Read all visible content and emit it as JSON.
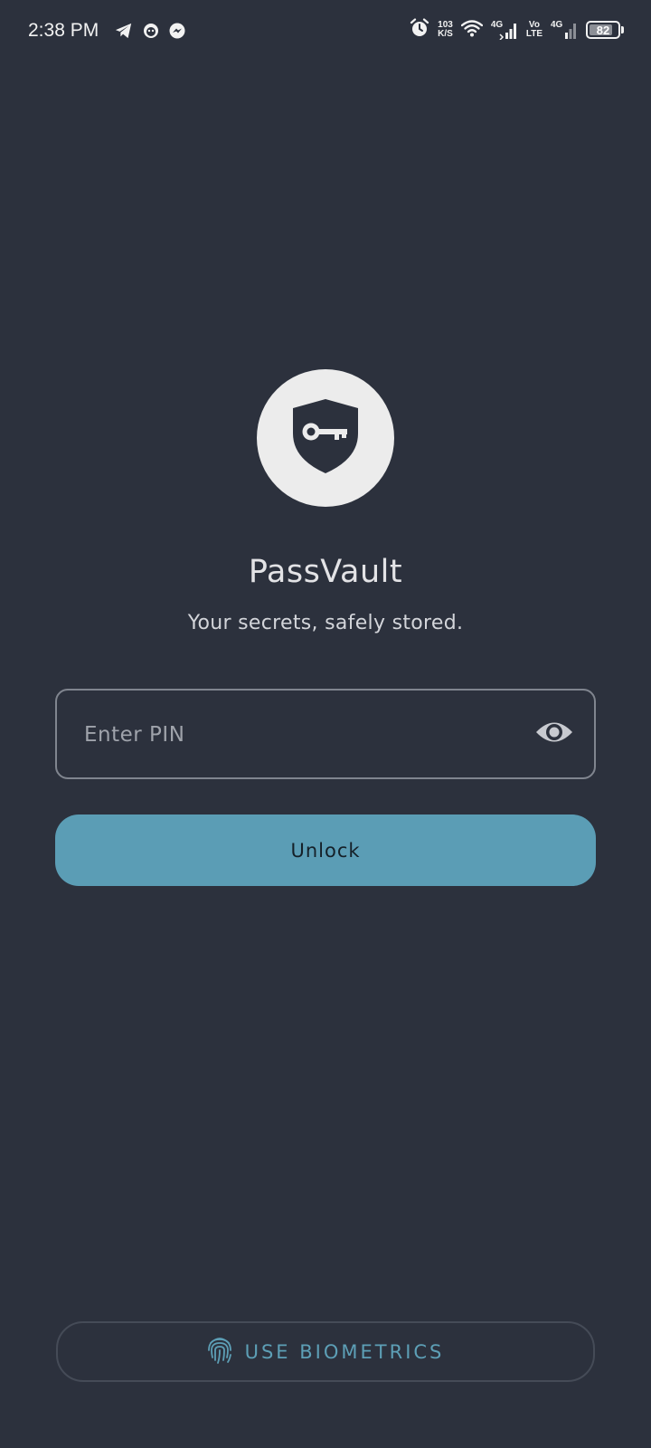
{
  "status_bar": {
    "time": "2:38 PM",
    "left_icons": [
      "telegram-icon",
      "app-notification-icon",
      "messenger-icon"
    ],
    "net_speed_value": "103",
    "net_speed_unit": "K/S",
    "sim1_label": "4G",
    "volte_top": "Vo",
    "volte_bottom": "LTE",
    "sim2_label": "4G",
    "battery_level": "82"
  },
  "app": {
    "logo_icon": "shield-key-icon",
    "title": "PassVault",
    "subtitle": "Your secrets, safely stored."
  },
  "pin": {
    "placeholder": "Enter PIN",
    "value": "",
    "toggle_icon": "eye-icon"
  },
  "unlock_label": "Unlock",
  "biometrics": {
    "icon": "fingerprint-icon",
    "label": "USE BIOMETRICS"
  },
  "colors": {
    "background": "#2c313d",
    "accent": "#5b9db5",
    "logo_bg": "#ececec"
  }
}
